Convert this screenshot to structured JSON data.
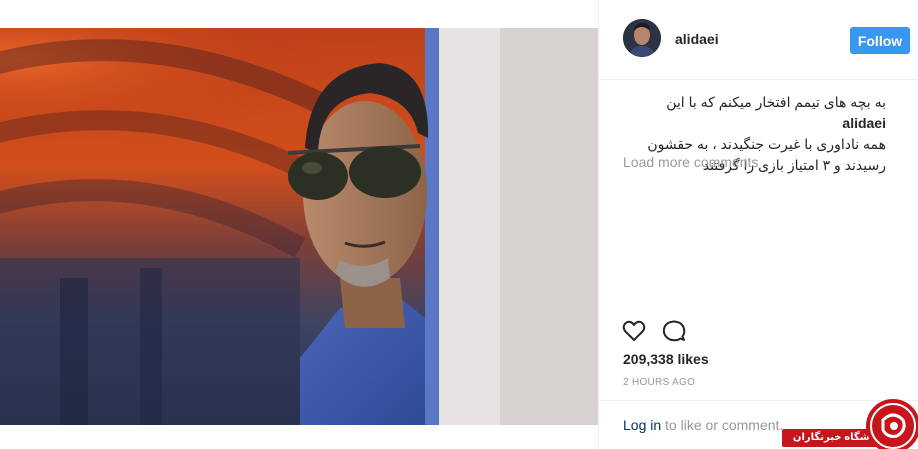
{
  "post": {
    "image_icon": "portrait-photo",
    "username": "alidaei",
    "follow_label": "Follow",
    "caption_user": "alidaei",
    "caption_line1": "به بچه های تیمم افتخار میکنم که با این",
    "caption_line2": "همه ناداوری با غیرت جنگیدند ، به حقشون",
    "caption_line3": "رسیدند و ۳ امتیاز بازی را گرفتند",
    "load_more": "Load more comments",
    "likes": "209,338 likes",
    "timestamp": "2 HOURS AGO",
    "login_link": "Log in",
    "login_rest": " to like or comment."
  },
  "icons": {
    "like": "heart-icon",
    "comment": "comment-icon"
  },
  "colors": {
    "follow_button": "#3897f0",
    "watermark_red": "#c8151b"
  },
  "watermark": {
    "text": "باشگاه خبرنگاران"
  }
}
